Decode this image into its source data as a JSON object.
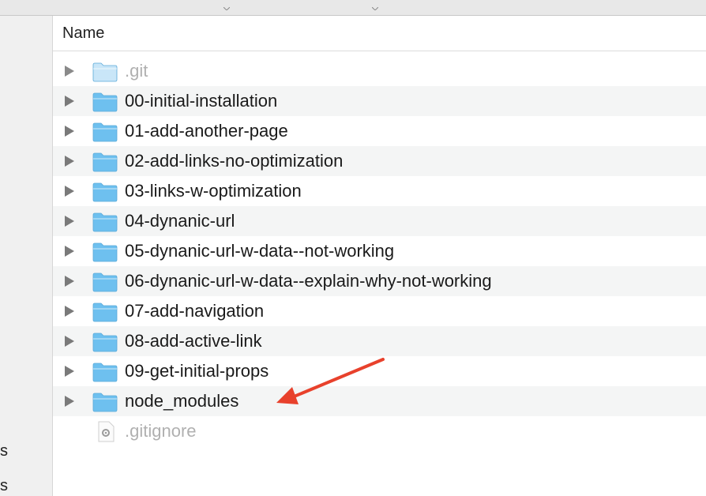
{
  "sidebar": {
    "items": [
      "s",
      "s"
    ]
  },
  "header": {
    "name_label": "Name"
  },
  "rows": [
    {
      "label": ".git",
      "kind": "folder",
      "dim": true,
      "expandable": true
    },
    {
      "label": "00-initial-installation",
      "kind": "folder",
      "dim": false,
      "expandable": true
    },
    {
      "label": "01-add-another-page",
      "kind": "folder",
      "dim": false,
      "expandable": true
    },
    {
      "label": "02-add-links-no-optimization",
      "kind": "folder",
      "dim": false,
      "expandable": true
    },
    {
      "label": "03-links-w-optimization",
      "kind": "folder",
      "dim": false,
      "expandable": true
    },
    {
      "label": "04-dynanic-url",
      "kind": "folder",
      "dim": false,
      "expandable": true
    },
    {
      "label": "05-dynanic-url-w-data--not-working",
      "kind": "folder",
      "dim": false,
      "expandable": true
    },
    {
      "label": "06-dynanic-url-w-data--explain-why-not-working",
      "kind": "folder",
      "dim": false,
      "expandable": true
    },
    {
      "label": "07-add-navigation",
      "kind": "folder",
      "dim": false,
      "expandable": true
    },
    {
      "label": "08-add-active-link",
      "kind": "folder",
      "dim": false,
      "expandable": true
    },
    {
      "label": "09-get-initial-props",
      "kind": "folder",
      "dim": false,
      "expandable": true
    },
    {
      "label": "node_modules",
      "kind": "folder",
      "dim": false,
      "expandable": true
    },
    {
      "label": ".gitignore",
      "kind": "file",
      "dim": true,
      "expandable": false
    }
  ],
  "annotation": {
    "icon": "red-arrow-icon",
    "color": "#e8412c"
  },
  "colors": {
    "folder": "#6ec0ef",
    "folder_dim": "#c9e6f8",
    "alt_row": "#f4f5f5"
  }
}
